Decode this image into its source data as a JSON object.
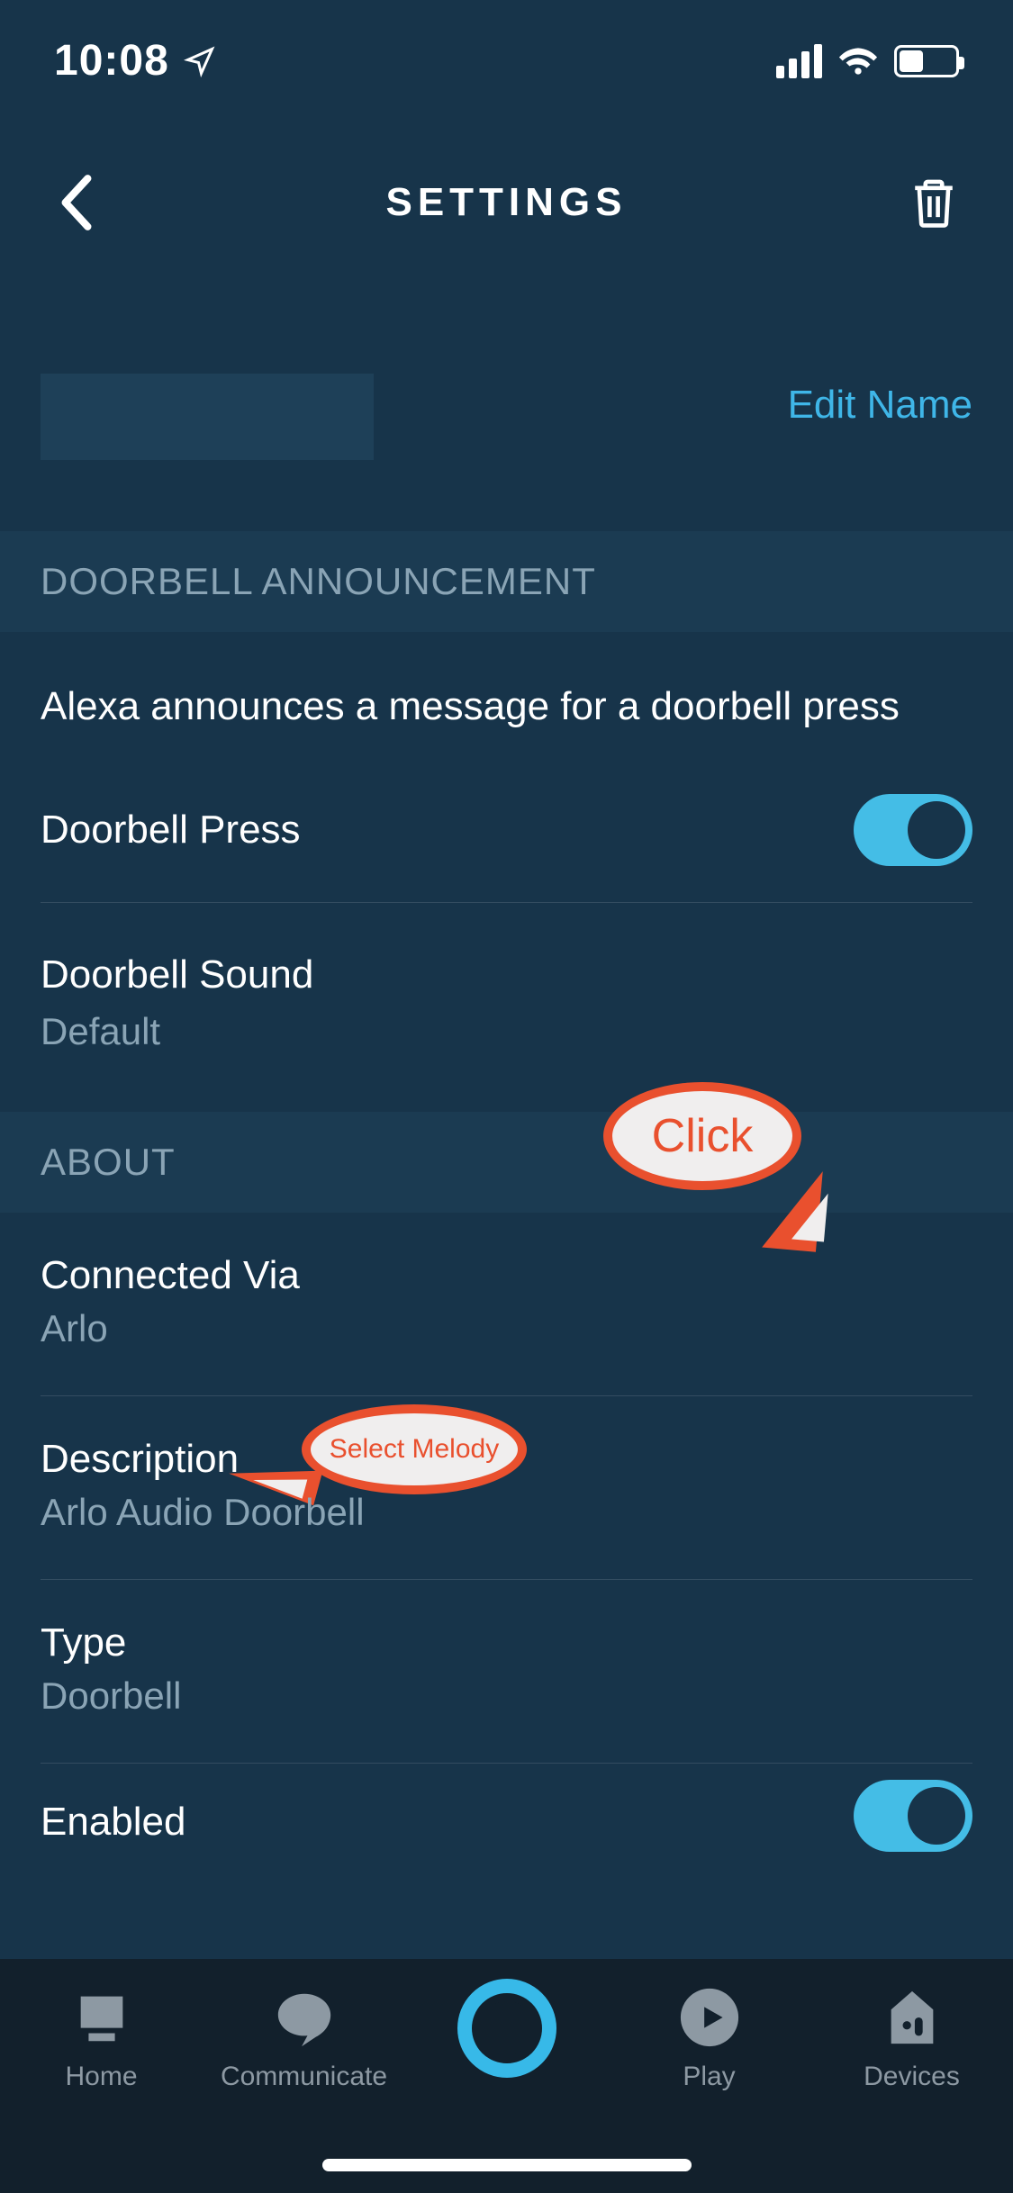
{
  "statusbar": {
    "time": "10:08"
  },
  "header": {
    "title": "SETTINGS"
  },
  "editname": {
    "link": "Edit Name"
  },
  "sections": {
    "doorbell": {
      "header": "DOORBELL ANNOUNCEMENT",
      "description": "Alexa announces a message for a doorbell press",
      "press_label": "Doorbell Press",
      "press_on": true,
      "sound_label": "Doorbell Sound",
      "sound_value": "Default"
    },
    "about": {
      "header": "ABOUT",
      "rows": [
        {
          "label": "Connected Via",
          "value": "Arlo"
        },
        {
          "label": "Description",
          "value": "Arlo Audio Doorbell"
        },
        {
          "label": "Type",
          "value": "Doorbell"
        }
      ],
      "enabled_label": "Enabled",
      "enabled_on": true
    }
  },
  "annotations": {
    "click": "Click",
    "select_melody": "Select Melody"
  },
  "tabs": {
    "home": "Home",
    "communicate": "Communicate",
    "play": "Play",
    "devices": "Devices"
  },
  "colors": {
    "accent": "#37b9e8",
    "link": "#3fb6e8",
    "callout": "#e9502e"
  }
}
